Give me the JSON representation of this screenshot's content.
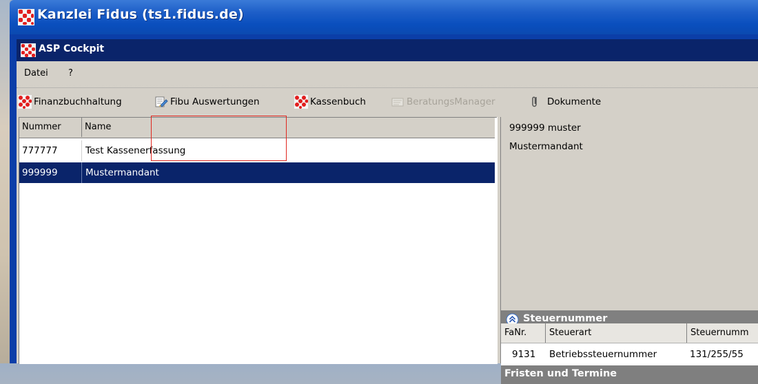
{
  "window": {
    "title": "Kanzlei Fidus (ts1.fidus.de)"
  },
  "app": {
    "title": "ASP Cockpit"
  },
  "menu": {
    "datei": "Datei",
    "help": "?"
  },
  "toolbar": {
    "finanzbuchhaltung": "Finanzbuchhaltung",
    "fibu_auswertungen": "Fibu Auswertungen",
    "kassenbuch": "Kassenbuch",
    "beratungsmanager": "BeratungsManager",
    "dokumente": "Dokumente"
  },
  "grid": {
    "headers": {
      "nummer": "Nummer",
      "name": "Name"
    },
    "rows": [
      {
        "nummer": "777777",
        "name": "Test Kassenerfassung",
        "selected": false
      },
      {
        "nummer": "999999",
        "name": "Mustermandant",
        "selected": true
      }
    ]
  },
  "detail": {
    "line1": "999999 muster",
    "line2": "Mustermandant"
  },
  "steuernummer": {
    "title": "Steuernummer",
    "headers": {
      "fanr": "FaNr.",
      "steuerart": "Steuerart",
      "steuernummer": "Steuernumm"
    },
    "row": {
      "fanr": "9131",
      "steuerart": "Betriebssteuernummer",
      "steuernummer": "131/255/55"
    }
  },
  "fristen": {
    "title": "Fristen und Termine"
  },
  "colors": {
    "titlebar": "#0a4fbe",
    "inner_titlebar": "#0a246a",
    "selection": "#0a246a",
    "highlight": "#e0261e",
    "chrome": "#d4d0c8"
  },
  "icons": [
    "fidus-logo-icon",
    "report-icon",
    "beratung-icon",
    "paperclip-icon",
    "collapse-up-icon"
  ]
}
